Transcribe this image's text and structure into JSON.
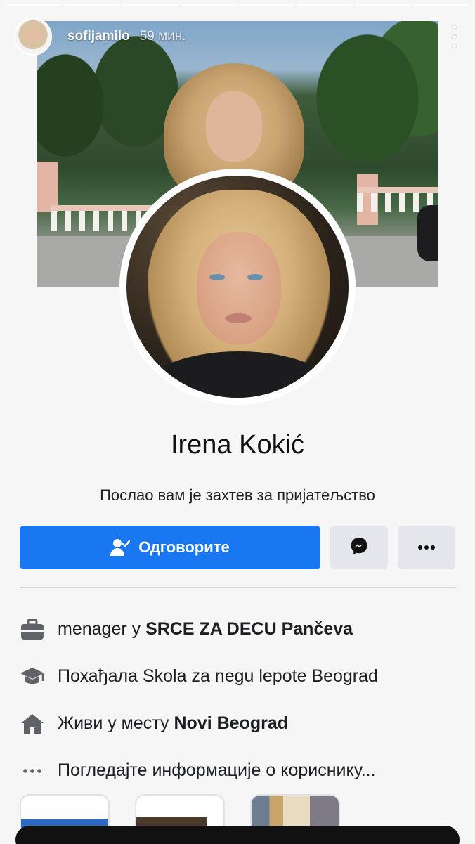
{
  "story": {
    "username": "sofijamilo",
    "time_ago": "59 мин.",
    "progress_segments": [
      true,
      true,
      true,
      true,
      true,
      true,
      true,
      true
    ]
  },
  "profile": {
    "name": "Irena Kokić",
    "subtitle": "Послао вам је захтев за пријатељство",
    "primary_button": "Одговорите",
    "info": [
      {
        "icon": "briefcase-icon",
        "prefix": "menager у ",
        "bold": "SRCE ZA DECU Pančeva",
        "suffix": ""
      },
      {
        "icon": "graduation-cap-icon",
        "prefix": "Похађала Skola za negu lepote Beograd",
        "bold": "",
        "suffix": ""
      },
      {
        "icon": "home-icon",
        "prefix": "Живи у месту ",
        "bold": "Novi Beograd",
        "suffix": ""
      },
      {
        "icon": "more-dots-icon",
        "prefix": "Погледајте информације о кориснику...",
        "bold": "",
        "suffix": ""
      }
    ]
  },
  "colors": {
    "primary": "#1a77f2",
    "secondary_button": "#e4e6eb",
    "icon_gray": "#5f6368"
  }
}
